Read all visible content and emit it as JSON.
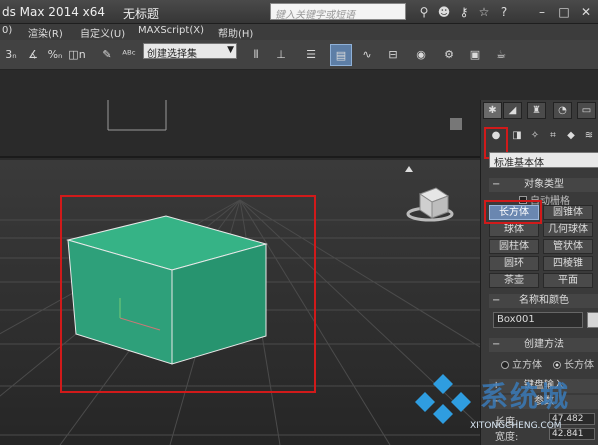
{
  "window": {
    "title": "ds Max  2014 x64",
    "document": "无标题"
  },
  "search": {
    "placeholder": "键入关键字或短语"
  },
  "menus": [
    "0)",
    "渲染(R)",
    "自定义(U)",
    "MAXScript(X)",
    "帮助(H)"
  ],
  "toolbar": {
    "selection_set": "创建选择集",
    "snap_labels": [
      "3",
      "%",
      "n"
    ]
  },
  "viewports": {
    "top_label": "",
    "perspective_label": ""
  },
  "command_panel": {
    "tabs": [
      "create",
      "modify",
      "hierarchy",
      "motion",
      "display"
    ],
    "category": "标准基本体",
    "object_type": {
      "header": "对象类型",
      "autogrid_label": "自动栅格",
      "buttons": [
        "长方体",
        "圆锥体",
        "球体",
        "几何球体",
        "圆柱体",
        "管状体",
        "圆环",
        "四棱锥",
        "茶壶",
        "平面"
      ],
      "selected": "长方体"
    },
    "name_color": {
      "header": "名称和颜色",
      "name_value": "Box001",
      "color": "#d6d6d6"
    },
    "creation_method": {
      "header": "创建方法",
      "options": [
        "立方体",
        "长方体"
      ],
      "selected": "长方体"
    },
    "keyboard_entry": {
      "header": "键盘输入"
    },
    "parameters": {
      "header": "参数",
      "fields": [
        {
          "label": "长度:",
          "value": "47.482"
        },
        {
          "label": "宽度:",
          "value": "42.841"
        }
      ]
    }
  },
  "scene": {
    "object_name": "Box001",
    "object_color": "#2fa87a"
  },
  "watermark": {
    "text": "系统城",
    "url": "XITONGCHENG.COM"
  },
  "colors": {
    "highlight": "#d11a1a",
    "active_button": "#6a87b0"
  }
}
